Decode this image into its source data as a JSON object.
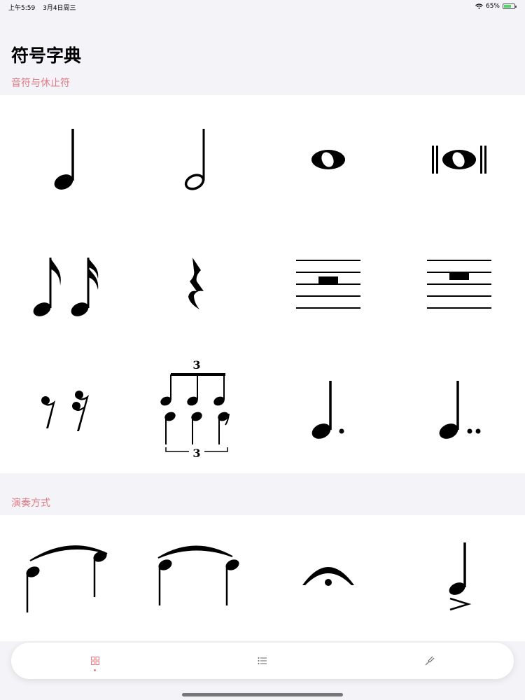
{
  "status_bar": {
    "time": "上午5:59",
    "date": "3月4日周三",
    "battery_percent": "65%",
    "battery_level": 0.65
  },
  "page": {
    "title": "符号字典"
  },
  "sections": [
    {
      "title": "音符与休止符",
      "symbols": [
        "quarter-note",
        "half-note",
        "whole-note",
        "double-whole-note",
        "eighth-and-sixteenth-notes",
        "quarter-rest",
        "whole-rest",
        "half-rest",
        "eighth-and-sixteenth-rests",
        "triplets",
        "dotted-quarter-note",
        "double-dotted-quarter-note"
      ]
    },
    {
      "title": "演奏方式",
      "symbols": [
        "tie",
        "slur",
        "fermata",
        "accent"
      ]
    }
  ],
  "tab_bar": {
    "tabs": [
      {
        "icon": "grid-icon",
        "selected": true
      },
      {
        "icon": "list-icon",
        "selected": false
      },
      {
        "icon": "tuning-fork-icon",
        "selected": false
      }
    ],
    "accent_color": "#e07a86"
  }
}
